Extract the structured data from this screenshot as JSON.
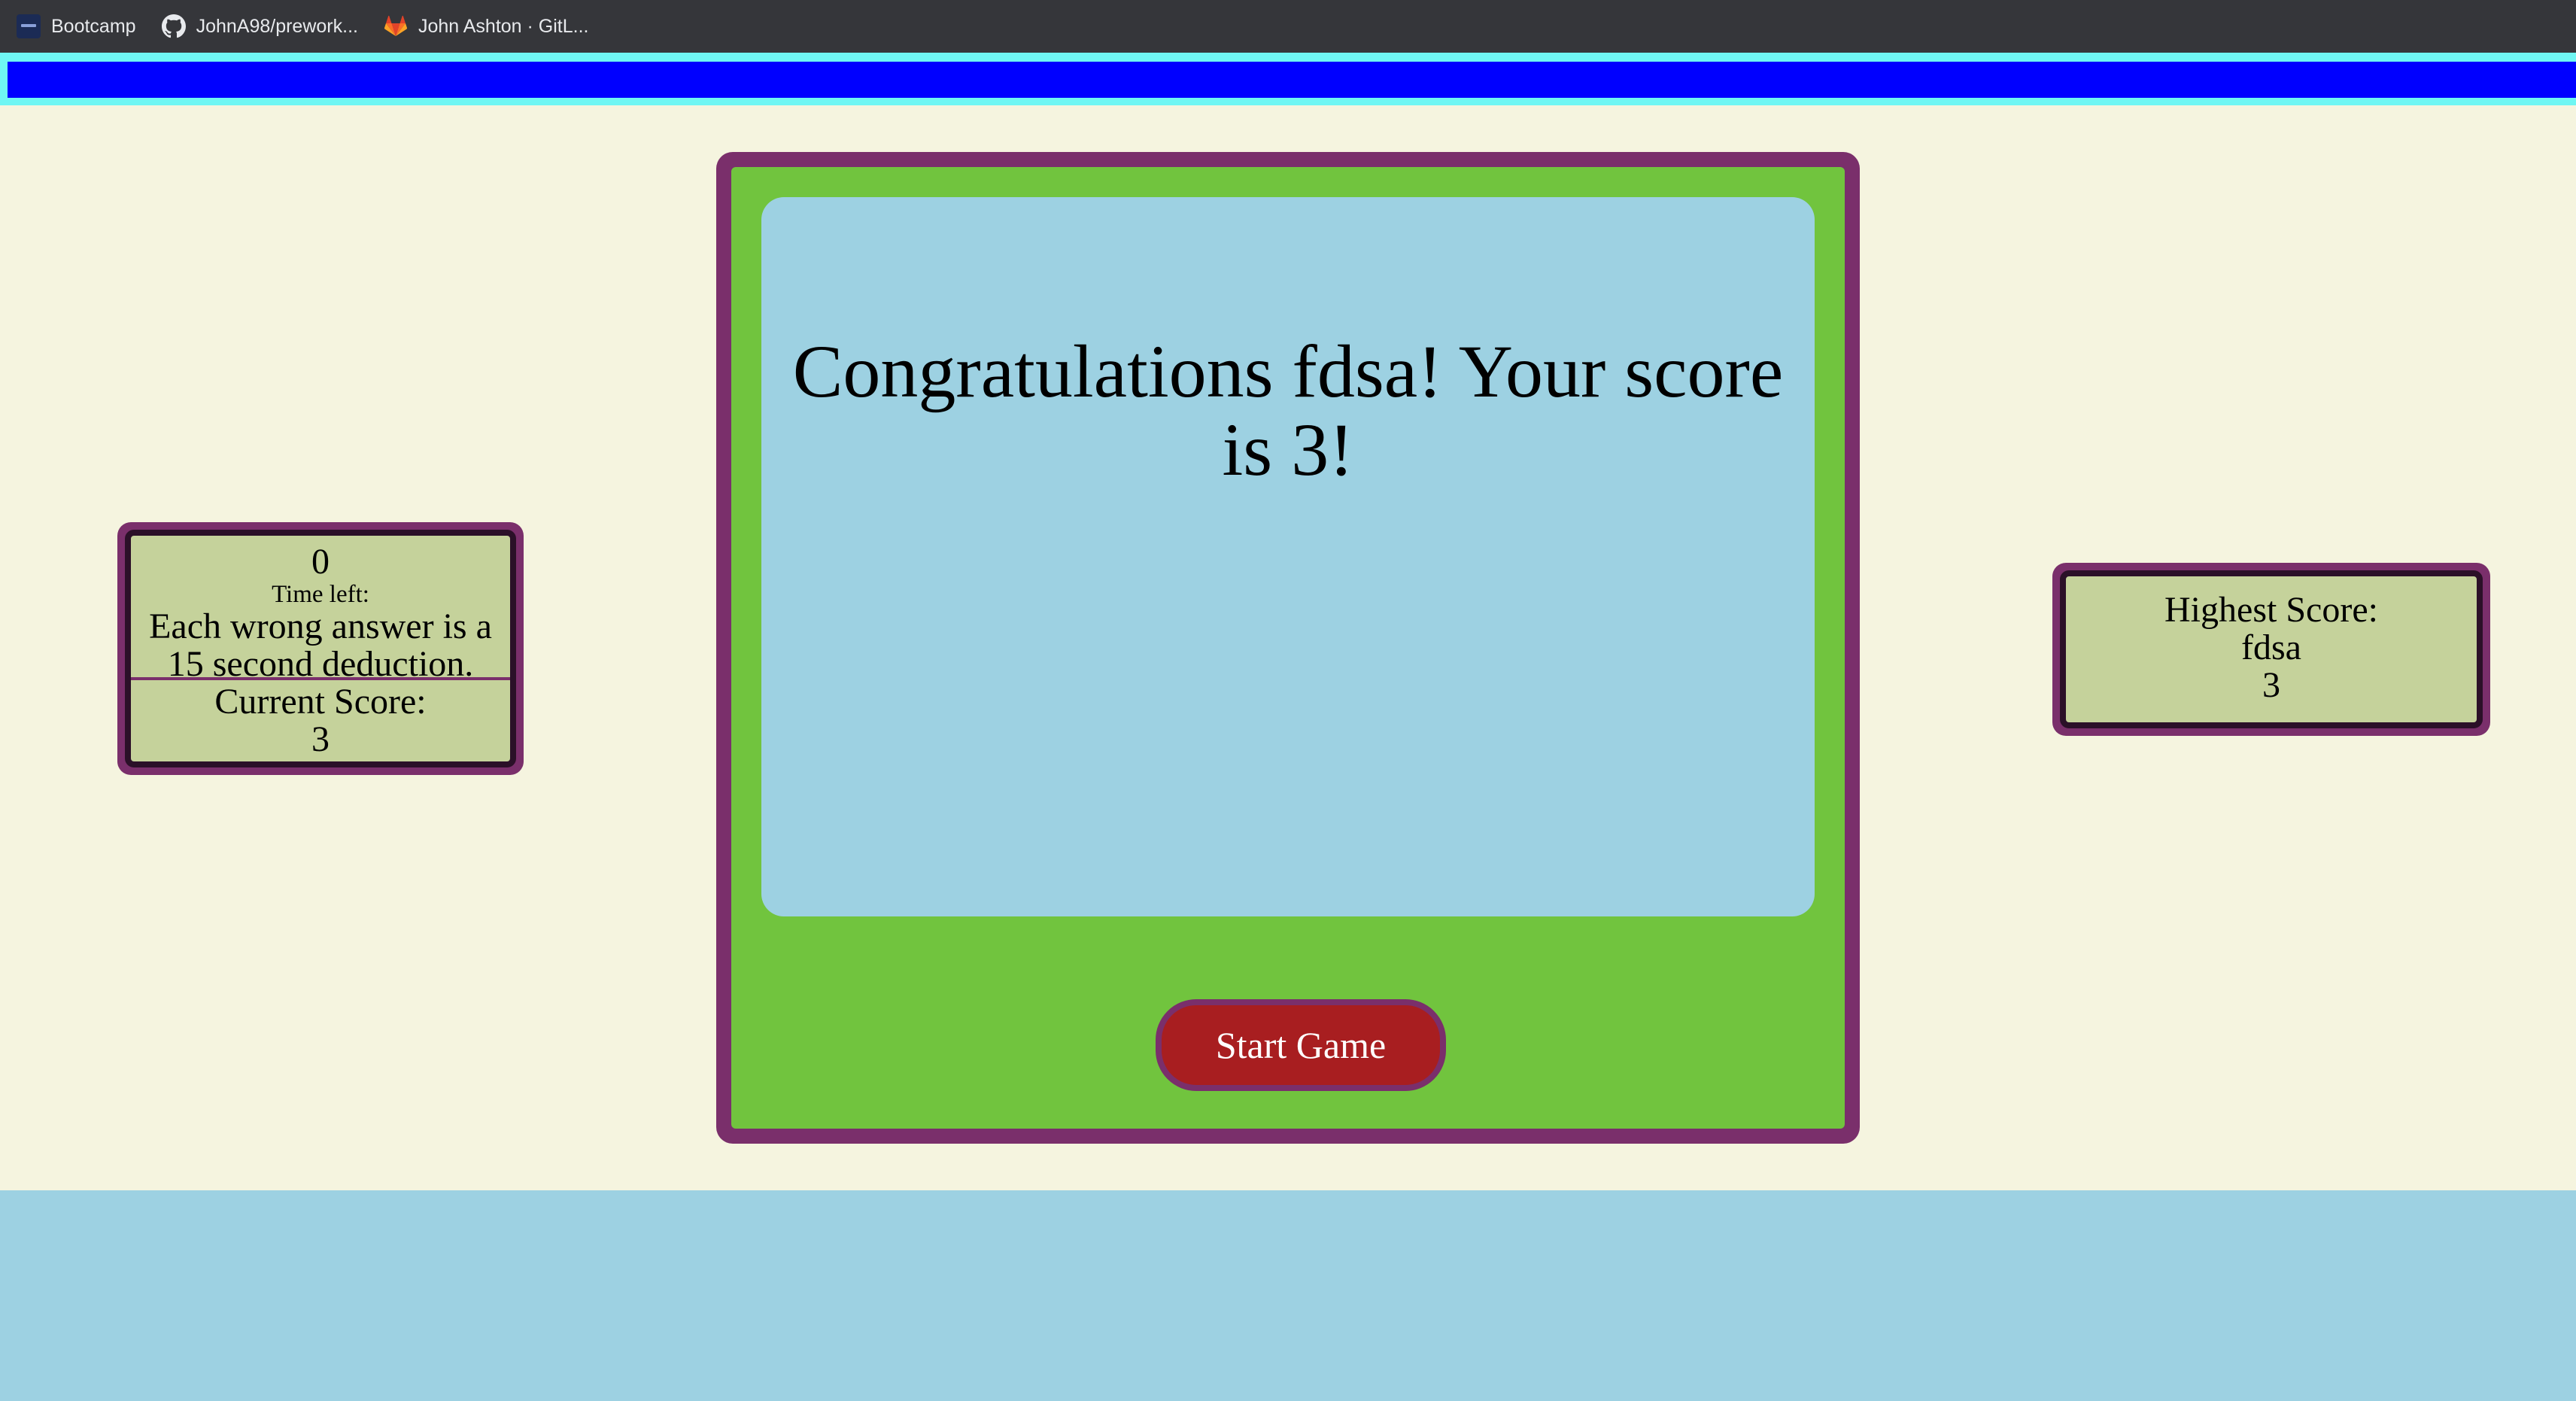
{
  "bookmarks": [
    {
      "label": "Bootcamp",
      "icon": "bootcamp-icon"
    },
    {
      "label": "JohnA98/prework...",
      "icon": "github-icon"
    },
    {
      "label": "John Ashton · GitL...",
      "icon": "gitlab-icon"
    }
  ],
  "progress": {
    "fraction": 1.0,
    "color": "#0000ff"
  },
  "timer": {
    "value": "0",
    "label": "Time left:",
    "note": "Each wrong answer is a 15 second deduction."
  },
  "current_score": {
    "label": "Current Score:",
    "value": "3"
  },
  "high_score": {
    "label": "Highest Score:",
    "name": "fdsa",
    "value": "3"
  },
  "main": {
    "message": "Congratulations fdsa! Your score is 3!",
    "start_button_label": "Start Game"
  },
  "colors": {
    "page_bg": "#f5f4df",
    "card_border": "#7a2f6b",
    "card_green": "#71c43e",
    "question_bg": "#9dd1e2",
    "panel_bg": "#c5d29b",
    "button_red": "#a81e20"
  }
}
